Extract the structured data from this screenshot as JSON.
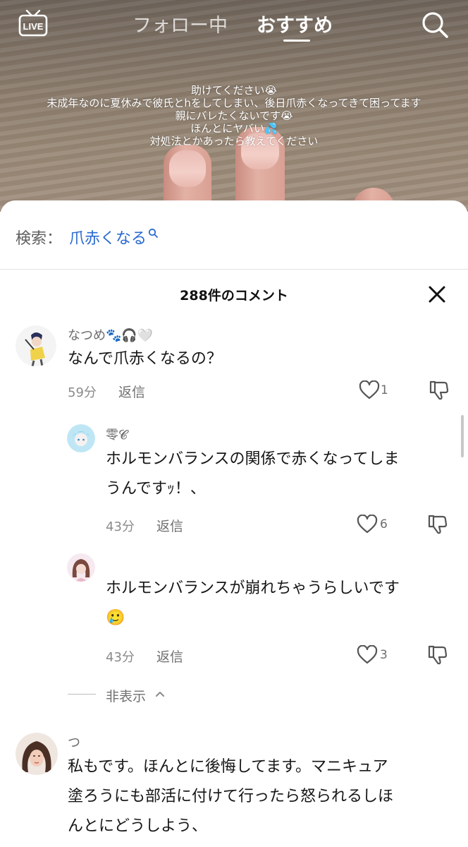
{
  "header": {
    "live_label": "LIVE",
    "tab_follow": "フォロー中",
    "tab_recommend": "おすすめ"
  },
  "video": {
    "overlay_lines": [
      "助けてください😭",
      "未成年なのに夏休みで彼氏とhをしてしまい、後日爪赤くなってきて困ってます",
      "親にバレたくないです😭",
      "ほんとにヤバい💦",
      "対処法とかあったら教えてください"
    ]
  },
  "search": {
    "label": "検索：",
    "term": "爪赤くなる"
  },
  "comments_header": {
    "count_text": "288件のコメント"
  },
  "comments": [
    {
      "name": "なつめ🐾🎧🤍",
      "text": "なんで爪赤くなるの？",
      "time": "59分",
      "reply_label": "返信",
      "likes": "1"
    },
    {
      "name": "零𝓒",
      "text_line1": "ホルモンバランスの関係で赤くなってしま",
      "text_line2": "うんですｯ！、",
      "time": "43分",
      "reply_label": "返信",
      "likes": "6"
    },
    {
      "name": "",
      "text_line1": "ホルモンバランスが崩れちゃうらしいです",
      "text_line2": "🥲",
      "time": "43分",
      "reply_label": "返信",
      "likes": "3"
    },
    {
      "name": "つ",
      "text_line1": "私もです。ほんとに後悔してます。マニキュア",
      "text_line2": "塗ろうにも部活に付けて行ったら怒られるしほ",
      "text_line3": "んとにどうしよう、"
    }
  ],
  "hide_replies_label": "非表示",
  "colors": {
    "link_blue": "#2a6ad0",
    "text_dark": "#161616",
    "meta_gray": "#8a8a8a"
  }
}
